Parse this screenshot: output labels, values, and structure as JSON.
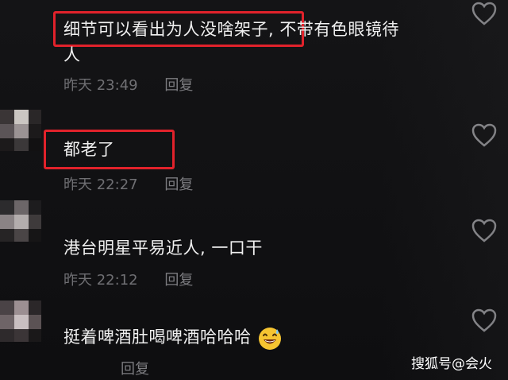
{
  "comments": [
    {
      "text_highlighted": "细节可以看出为人没啥架子,",
      "text_rest": " 不带有色眼镜待",
      "text_line2": "人",
      "time": "昨天 23:49",
      "reply": "回复",
      "liked": false
    },
    {
      "text_highlighted": "都老了",
      "time": "昨天 22:27",
      "reply": "回复",
      "liked": false
    },
    {
      "text": "港台明星平易近人, 一口干",
      "time": "昨天 22:12",
      "reply": "回复",
      "liked": false
    },
    {
      "text": "挺着啤酒肚喝啤酒哈哈哈",
      "emoji": "grinning-sweat-emoji",
      "time": "",
      "reply": "回复",
      "liked": false
    }
  ],
  "watermark": "搜狐号@会火",
  "colors": {
    "background": "#111113",
    "text": "#f0f0f0",
    "meta": "#6f6f73",
    "highlight_box": "#e1222b",
    "heart": "#9a9a9e"
  },
  "icons": [
    "heart-outline-icon",
    "grinning-sweat-emoji"
  ]
}
